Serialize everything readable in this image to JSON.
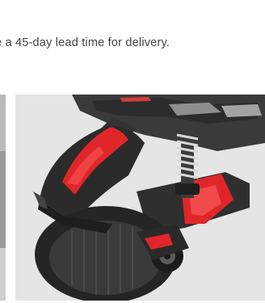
{
  "notice": {
    "text": "e a 45-day lead time for delivery."
  },
  "gallery": {
    "images": [
      {
        "name": "previous-product-image-partial"
      },
      {
        "name": "rear-wheel-suspension-image"
      }
    ]
  },
  "colors": {
    "accent_red": "#e0262b",
    "body_dark": "#2b2b2b",
    "background": "#e4e4e4"
  }
}
